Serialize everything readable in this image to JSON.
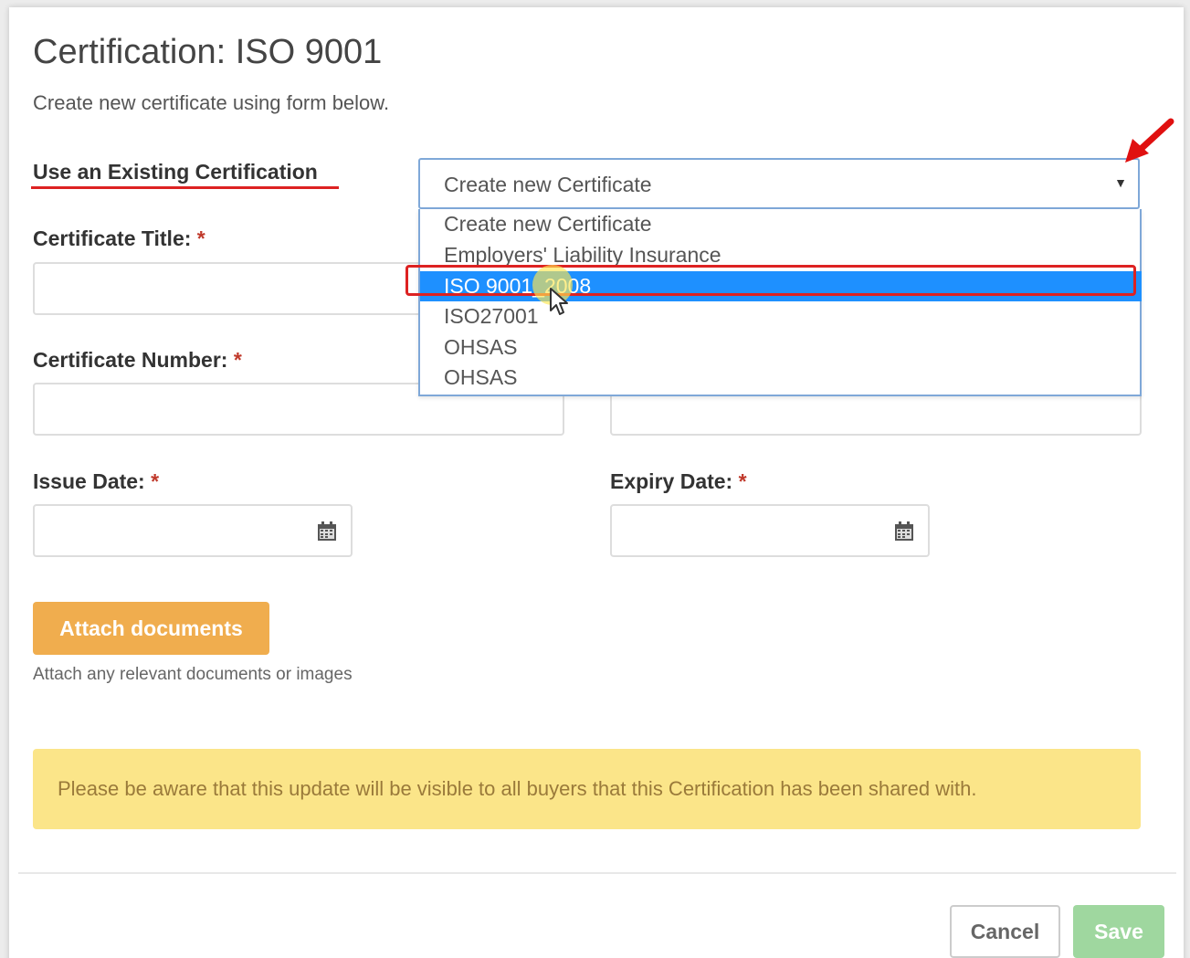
{
  "modal": {
    "title": "Certification: ISO 9001",
    "subtitle": "Create new certificate using form below."
  },
  "existing": {
    "label": "Use an Existing Certification",
    "selected_value": "Create new Certificate",
    "options": [
      "Create new Certificate",
      "Employers' Liability Insurance",
      "ISO 9001_2008",
      "ISO27001",
      "OHSAS",
      "OHSAS"
    ],
    "highlighted_option": "ISO 9001_2008"
  },
  "fields": {
    "certificate_title_label": "Certificate Title:",
    "certificate_number_label": "Certificate Number:",
    "issue_date_label": "Issue Date:",
    "expiry_date_label": "Expiry Date:",
    "required_marker": "*"
  },
  "attach": {
    "button_label": "Attach documents",
    "help_text": "Attach any relevant documents or images"
  },
  "notice": {
    "text": "Please be aware that this update will be visible to all buyers that this Certification has been shared with."
  },
  "footer": {
    "cancel_label": "Cancel",
    "save_label": "Save"
  },
  "colors": {
    "attach_button": "#f0ad4e",
    "save_button": "#9fd79f",
    "notice_background": "#fbe589",
    "dropdown_highlight": "#1e90ff",
    "annotation_red": "#dd2222"
  },
  "icons": [
    "calendar-icon",
    "caret-down-icon",
    "red-arrow-annotation",
    "mouse-pointer-icon"
  ]
}
